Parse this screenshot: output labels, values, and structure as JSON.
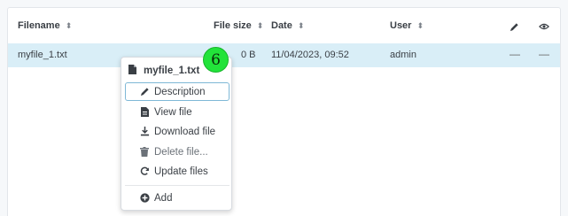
{
  "table": {
    "columns": {
      "filename": "Filename",
      "filesize": "File size",
      "date": "Date",
      "user": "User"
    },
    "sort_glyph": "⬍",
    "header_icons": [
      "pencil-icon",
      "eye-icon"
    ],
    "rows": [
      {
        "filename": "myfile_1.txt",
        "size": "0 B",
        "date": "11/04/2023, 09:52",
        "user": "admin",
        "desc_placeholder": "—",
        "view_placeholder": "—"
      }
    ]
  },
  "badge": {
    "number": "6",
    "color": "#22e33a"
  },
  "context_menu": {
    "title": "myfile_1.txt",
    "items": [
      {
        "label": "Description",
        "icon": "pencil-icon"
      },
      {
        "label": "View file",
        "icon": "file-icon"
      },
      {
        "label": "Download file",
        "icon": "download-icon"
      },
      {
        "label": "Delete file...",
        "icon": "trash-icon"
      },
      {
        "label": "Update files",
        "icon": "refresh-icon"
      },
      {
        "label": "Add",
        "icon": "plus-circle-icon"
      }
    ]
  },
  "colors": {
    "selected_row": "#d9eef7",
    "active_item_border": "#7fb8d6"
  }
}
